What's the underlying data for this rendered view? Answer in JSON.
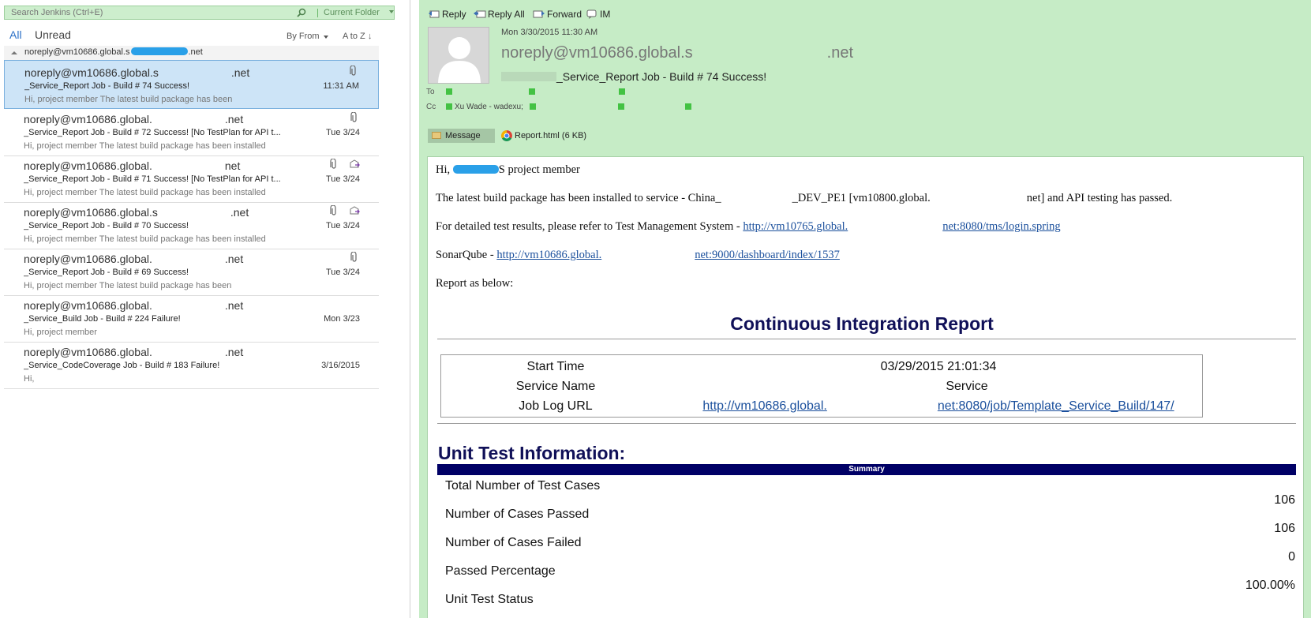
{
  "search": {
    "placeholder": "Search Jenkins (Ctrl+E)",
    "scope": "Current Folder"
  },
  "filters": {
    "all": "All",
    "unread": "Unread",
    "sort_by": "By From",
    "sort_order": "A to Z"
  },
  "group_header": "noreply@vm10686.global.s",
  "mails": [
    {
      "sender": "noreply@vm10686.global.s",
      "sender_tail": ".net",
      "subject": "_Service_Report Job - Build # 74 Success!",
      "preview": "Hi,          project member   The latest build package has been",
      "date": "11:31 AM",
      "attachment": true,
      "forwarded": false,
      "selected": true
    },
    {
      "sender": "noreply@vm10686.global.",
      "sender_tail": ".net",
      "subject": "_Service_Report Job - Build # 72 Success! [No TestPlan for API t...",
      "preview": "Hi,          project member   The latest build package has been installed",
      "date": "Tue 3/24",
      "attachment": true,
      "forwarded": false,
      "selected": false
    },
    {
      "sender": "noreply@vm10686.global.",
      "sender_tail": "net",
      "subject": "_Service_Report Job - Build # 71 Success! [No TestPlan for API t...",
      "preview": "Hi,          project member   The latest build package has been installed",
      "date": "Tue 3/24",
      "attachment": true,
      "forwarded": true,
      "selected": false
    },
    {
      "sender": "noreply@vm10686.global.s",
      "sender_tail": ".net",
      "subject": "_Service_Report Job - Build # 70 Success!",
      "preview": "Hi,          project member   The latest build package has been installed",
      "date": "Tue 3/24",
      "attachment": true,
      "forwarded": true,
      "selected": false
    },
    {
      "sender": "noreply@vm10686.global.",
      "sender_tail": ".net",
      "subject": "_Service_Report Job - Build # 69 Success!",
      "preview": "Hi,          project member   The latest build package has been",
      "date": "Tue 3/24",
      "attachment": true,
      "forwarded": false,
      "selected": false
    },
    {
      "sender": "noreply@vm10686.global.",
      "sender_tail": ".net",
      "subject": "_Service_Build Job - Build # 224 Failure!",
      "preview": "Hi,               project member",
      "date": "Mon 3/23",
      "attachment": false,
      "forwarded": false,
      "selected": false
    },
    {
      "sender": "noreply@vm10686.global.",
      "sender_tail": ".net",
      "subject": "_Service_CodeCoverage Job - Build # 183 Failure!",
      "preview": "Hi,",
      "date": "3/16/2015",
      "attachment": false,
      "forwarded": false,
      "selected": false
    }
  ],
  "toolbar": {
    "reply": "Reply",
    "reply_all": "Reply All",
    "forward": "Forward",
    "im": "IM"
  },
  "message": {
    "date": "Mon 3/30/2015 11:30 AM",
    "from": "noreply@vm10686.global.s",
    "from_tail": ".net",
    "subject": "_Service_Report Job - Build # 74 Success!",
    "to_label": "To",
    "cc_label": "Cc",
    "cc_first": "Xu Wade - wadexu;",
    "attachments": {
      "message": "Message",
      "report": "Report.html (6 KB)"
    }
  },
  "body": {
    "greeting_prefix": "Hi,",
    "greeting_suffix": "S project member",
    "line1": "The latest build package has been installed to service - China_",
    "line1_mid": "_DEV_PE1 [vm10800.global.",
    "line1_end": "net] and API testing has passed.",
    "line2": "For detailed test results, please refer to Test Management System - ",
    "tms_link": "http://vm10765.global.",
    "tms_link_end": "net:8080/tms/login.spring",
    "sonar_label": "SonarQube - ",
    "sonar_link": "http://vm10686.global.",
    "sonar_link_end": "net:9000/dashboard/index/1537",
    "report_line": "Report as below:"
  },
  "report": {
    "title": "Continuous Integration Report",
    "start_time_label": "Start Time",
    "start_time": "03/29/2015 21:01:34",
    "service_name_label": "Service Name",
    "service_name": "Service",
    "job_log_label": "Job Log URL",
    "job_log_url": "http://vm10686.global.",
    "job_log_url_end": "net:8080/job/Template_Service_Build/147/",
    "unit_title": "Unit Test Information:",
    "summary": "Summary",
    "total_label": "Total Number of Test Cases",
    "total": "106",
    "passed_label": "Number of Cases Passed",
    "passed": "106",
    "failed_label": "Number of Cases Failed",
    "failed": "0",
    "pct_label": "Passed Percentage",
    "pct": "100.00%",
    "status_label": "Unit Test Status"
  },
  "colors": {
    "accent": "#2a6fc6",
    "pane": "#c6ecc6",
    "search": "#cdeecd",
    "selected": "#cde4f7",
    "report_title": "#101058",
    "presence": "#43c243"
  }
}
